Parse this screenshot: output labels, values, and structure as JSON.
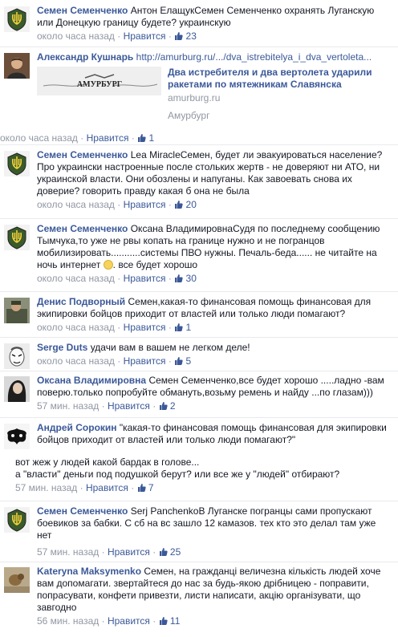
{
  "ui": {
    "like_label": "Нравится",
    "separator": " · "
  },
  "comments": [
    {
      "author": "Семен Семенченко",
      "text": "Антон ЕлащукСемен Семенченко охранять Луганскую или Донецкую границу будете? украинскую",
      "time": "около часа назад",
      "likes": "23"
    },
    {
      "author": "Александр Кушнарь",
      "link": "http://amurburg.ru/.../dva_istrebitelya_i_dva_vertoleta...",
      "preview": {
        "title": "Два истребителя и два вертолета ударили ракетами по мятежникам Славянска",
        "domain": "amurburg.ru",
        "logo_text": "АМУРБУРГ",
        "site_name": "Амурбург"
      },
      "time": "около часа назад",
      "likes": "1"
    },
    {
      "author": "Семен Семенченко",
      "text": "Lea MiracleСемен, будет ли эвакуироваться население? Про украински настроенные после стольких жертв - не доверяют ни АТО, ни украинской власти. Они обозлены и напуганы. Как завоевать снова их доверие? говорить правду какая б она не была",
      "time": "около часа назад",
      "likes": "20"
    },
    {
      "author": "Семен Семенченко",
      "text": "Оксана ВладимировнаСудя по последнему сообщению Тымчука,то уже не рвы копать на границе нужно и не погранцов мобилизировать...........системы ПВО нужны. Печаль-беда...... не читайте на ночь интернет",
      "text_after": ". все будет хорошо",
      "time": "около часа назад",
      "likes": "30"
    },
    {
      "author": "Денис Подворный",
      "text": "Семен,какая-то финансовая помощь финансовая для экипировки бойцов приходит от властей или только люди помагают?",
      "time": "около часа назад",
      "likes": "1"
    },
    {
      "author": "Serge Duts",
      "text": "удачи вам в вашем не легком деле!",
      "time": "около часа назад",
      "likes": "5"
    },
    {
      "author": "Оксана Владимировна",
      "text": "Семен Семенченко,все будет хорошо .....ладно -вам поверю.только попробуйте обмануть,возьму ремень и найду ...по глазам)))",
      "time": "57 мин. назад",
      "likes": "2"
    },
    {
      "author": "Андрей Сорокин",
      "text": "\"какая-то финансовая помощь финансовая для экипировки бойцов приходит от властей или только люди помагают?\"",
      "text2": "вот жеж у людей какой бардак в голове...",
      "text3": "а \"власти\" деньги под подушкой берут? или все же у \"людей\" отбирают?",
      "time": "57 мин. назад",
      "likes": "7"
    },
    {
      "author": "Семен Семенченко",
      "text": "Serj PanchenkoВ Луганске погранцы сами пропускают боевиков за бабки. С сб на вс зашло 12 камазов. тех кто это делал там уже нет",
      "time": "57 мин. назад",
      "likes": "25"
    },
    {
      "author": "Kateryna Maksymenko",
      "text": "Семен, на гражданці величезна кількість людей хоче вам допомагати. звертайтеся до нас за будь-якою дрібницею - поправити, попрасувати, конфети привезти, листи написати, акцію організувати, що завгодно",
      "time": "56 мин. назад",
      "likes": "11"
    }
  ],
  "colors": {
    "link": "#3b5998",
    "meta": "#9197a3",
    "divider": "#e9eaed",
    "avatar_green": "#3a5a2a"
  }
}
